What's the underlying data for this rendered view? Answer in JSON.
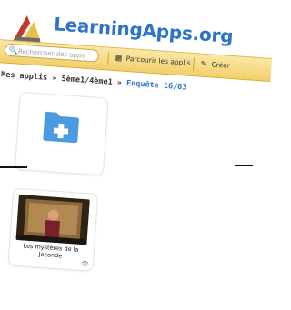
{
  "site": {
    "logo_text": "LearningApps.org"
  },
  "toolbar": {
    "search_placeholder": "Rechercher des apps",
    "browse_label": "Parcourir les applis",
    "create_label": "Créer"
  },
  "breadcrumb": {
    "root": "Mes applis",
    "separator1": "»",
    "level": "5ème1/4ème1",
    "separator2": "»",
    "current": "Enquête 16/03"
  },
  "items": [
    {
      "type": "folder",
      "icon": "folder-plus-icon"
    },
    {
      "type": "app",
      "title": "Les mystères de la Joconde",
      "icon": "eye-icon"
    }
  ],
  "colors": {
    "brand_blue": "#2d74c8",
    "toolbar_yellow": "#f2cf6a",
    "folder_blue": "#4a9be0"
  }
}
